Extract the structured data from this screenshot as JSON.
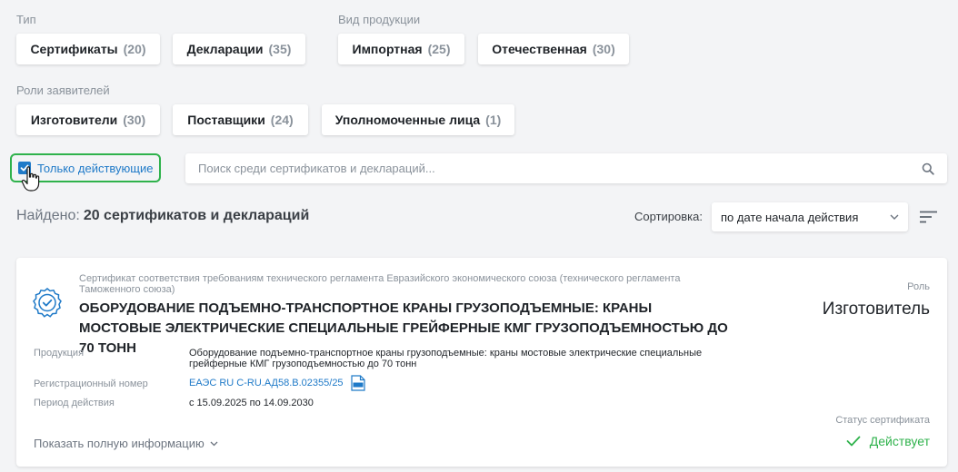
{
  "filters": {
    "type_label": "Тип",
    "type_chips": [
      {
        "label": "Сертификаты",
        "count": "(20)"
      },
      {
        "label": "Декларации",
        "count": "(35)"
      }
    ],
    "product_label": "Вид продукции",
    "product_chips": [
      {
        "label": "Импортная",
        "count": "(25)"
      },
      {
        "label": "Отечественная",
        "count": "(30)"
      }
    ],
    "roles_label": "Роли заявителей",
    "role_chips": [
      {
        "label": "Изготовители",
        "count": "(30)"
      },
      {
        "label": "Поставщики",
        "count": "(24)"
      },
      {
        "label": "Уполномоченные лица",
        "count": "(1)"
      }
    ],
    "only_active_label": "Только действующие",
    "only_active_checked": true
  },
  "search": {
    "placeholder": "Поиск среди сертификатов и деклараций..."
  },
  "results": {
    "found_label": "Найдено:",
    "found_value": "20 сертификатов и деклараций",
    "sort_label": "Сортировка:",
    "sort_value": "по дате начала действия"
  },
  "card": {
    "subtitle": "Сертификат соответствия требованиям технического регламента Евразийского экономического союза (технического регламента Таможенного союза)",
    "title": "ОБОРУДОВАНИЕ ПОДЪЕМНО-ТРАНСПОРТНОЕ КРАНЫ ГРУЗОПОДЪЕМНЫЕ: КРАНЫ МОСТОВЫЕ ЭЛЕКТРИЧЕСКИЕ СПЕЦИАЛЬНЫЕ ГРЕЙФЕРНЫЕ КМГ ГРУЗОПОДЪЕМНОСТЬЮ ДО 70 ТОНН",
    "role_label": "Роль",
    "role_value": "Изготовитель",
    "product_label": "Продукция",
    "product_value": "Оборудование подъемно-транспортное краны грузоподъемные: краны мостовые электрические специальные грейферные КМГ грузоподъемностью до 70 тонн",
    "reg_label": "Регистрационный номер",
    "reg_value": "ЕАЭС RU C-RU.АД58.В.02355/25",
    "period_label": "Период действия",
    "period_value": "с 15.09.2025 по 14.09.2030",
    "status_label": "Статус сертификата",
    "status_value": "Действует",
    "show_more_label": "Показать полную информацию"
  },
  "colors": {
    "accent": "#1f7ac8",
    "success": "#2fb24c",
    "muted": "#8a929b"
  },
  "icons": [
    "check-icon",
    "cursor-hand-icon",
    "search-icon",
    "chevron-down-icon",
    "sort-icon",
    "certificate-badge-icon",
    "pdf-icon",
    "status-check-icon"
  ]
}
